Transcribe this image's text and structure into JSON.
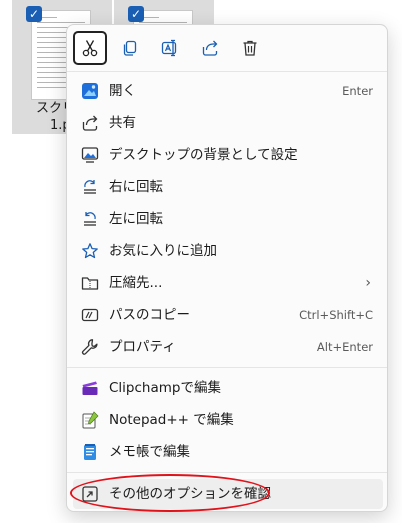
{
  "explorer": {
    "files": [
      {
        "name_line1": "スクリーン",
        "name_line2": "1.p",
        "checked": true
      },
      {
        "name_line1": "",
        "name_line2": "",
        "checked": true
      }
    ]
  },
  "quick_actions": [
    {
      "name": "cut",
      "icon": "scissors-icon"
    },
    {
      "name": "copy",
      "icon": "copy-icon"
    },
    {
      "name": "rename",
      "icon": "rename-icon"
    },
    {
      "name": "share",
      "icon": "share-icon"
    },
    {
      "name": "delete",
      "icon": "trash-icon"
    }
  ],
  "menu": {
    "open": {
      "label": "開く",
      "shortcut": "Enter"
    },
    "share": {
      "label": "共有"
    },
    "set_background": {
      "label": "デスクトップの背景として設定"
    },
    "rotate_right": {
      "label": "右に回転"
    },
    "rotate_left": {
      "label": "左に回転"
    },
    "favorites": {
      "label": "お気に入りに追加"
    },
    "compress": {
      "label": "圧縮先...",
      "chevron": "›"
    },
    "copy_path": {
      "label": "パスのコピー",
      "shortcut": "Ctrl+Shift+C"
    },
    "properties": {
      "label": "プロパティ",
      "shortcut": "Alt+Enter"
    },
    "clipchamp": {
      "label": "Clipchampで編集"
    },
    "notepadpp": {
      "label": "Notepad++ で編集"
    },
    "notepad": {
      "label": "メモ帳で編集"
    },
    "more_options": {
      "label": "その他のオプションを確認"
    }
  },
  "colors": {
    "accent": "#1a5fb4",
    "annotation": "#e0131b"
  }
}
